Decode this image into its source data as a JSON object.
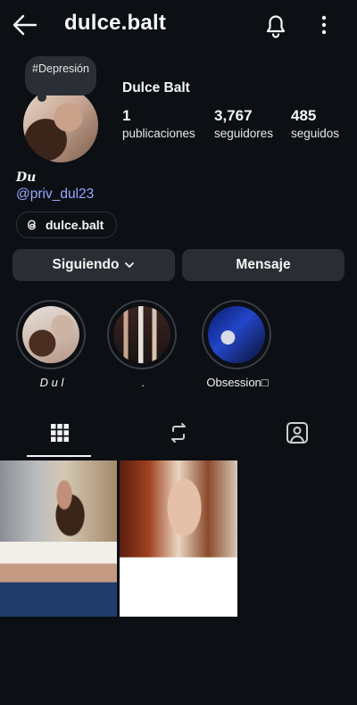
{
  "header": {
    "username": "dulce.balt"
  },
  "profile": {
    "note": "#Depresión",
    "display_name": "Dulce Balt",
    "stats": [
      {
        "value": "1",
        "label": "publicaciones"
      },
      {
        "value": "3,767",
        "label": "seguidores"
      },
      {
        "value": "485",
        "label": "seguidos"
      }
    ],
    "bio_name": "Du",
    "bio_link": "@priv_dul23",
    "threads_label": "dulce.balt"
  },
  "actions": {
    "follow_label": "Siguiendo",
    "message_label": "Mensaje"
  },
  "highlights": [
    {
      "label": "D u l"
    },
    {
      "label": "."
    },
    {
      "label": "Obsession□"
    }
  ],
  "tabs": {
    "icons": [
      "grid-icon",
      "reels-icon",
      "tagged-icon"
    ],
    "active": "grid"
  },
  "colors": {
    "background": "#0c0f14",
    "button": "#2a2d33",
    "link": "#9aa8ff"
  }
}
